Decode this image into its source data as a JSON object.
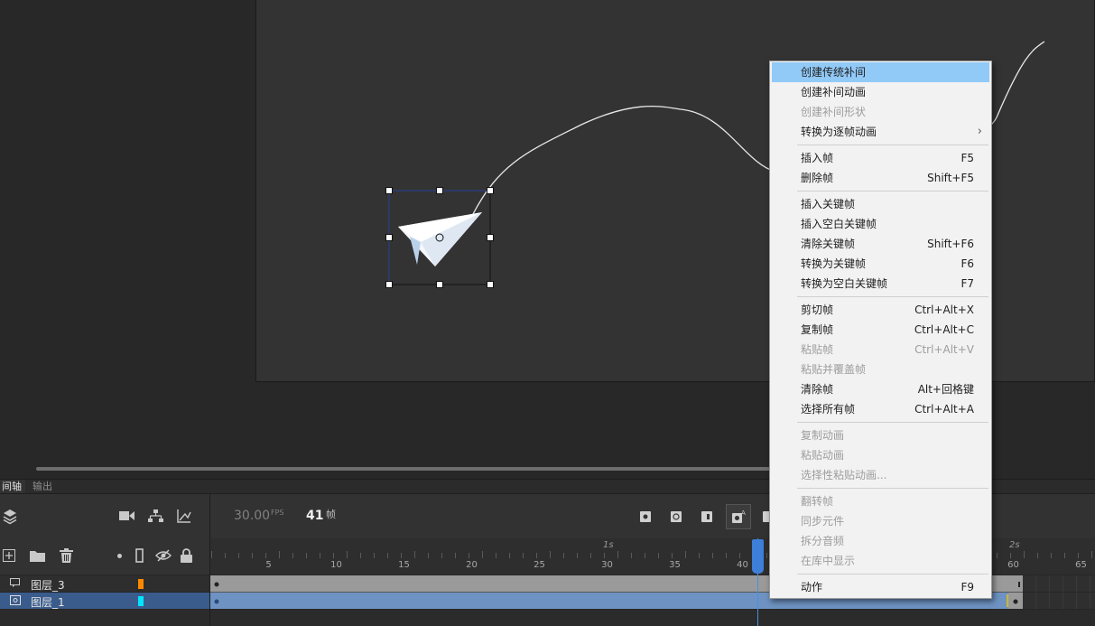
{
  "panel_tabs": {
    "timeline": "间轴",
    "output": "输出"
  },
  "toolbar": {
    "fps": "30.00",
    "fps_unit": "FPS",
    "frame": "41",
    "frame_unit": "帧"
  },
  "ruler": {
    "labels": [
      "5",
      "10",
      "15",
      "20",
      "25",
      "30",
      "35",
      "40",
      "45",
      "50",
      "55",
      "60",
      "65"
    ],
    "seconds": [
      "1s",
      "2s"
    ]
  },
  "layers": [
    {
      "name": "图层_3",
      "color": "#ff8a00",
      "selected": false
    },
    {
      "name": "图层_1",
      "color": "#00e5ff",
      "selected": true
    }
  ],
  "current_frame": 41,
  "context_menu": {
    "items": [
      {
        "label": "创建传统补间",
        "shortcut": "",
        "disabled": false,
        "highlighted": true
      },
      {
        "label": "创建补间动画",
        "shortcut": "",
        "disabled": false
      },
      {
        "label": "创建补间形状",
        "shortcut": "",
        "disabled": true
      },
      {
        "label": "转换为逐帧动画",
        "shortcut": "",
        "disabled": false,
        "submenu": true,
        "submenu_glyph": "›"
      },
      {
        "sep": true
      },
      {
        "label": "插入帧",
        "shortcut": "F5",
        "disabled": false
      },
      {
        "label": "删除帧",
        "shortcut": "Shift+F5",
        "disabled": false
      },
      {
        "sep": true
      },
      {
        "label": "插入关键帧",
        "shortcut": "",
        "disabled": false
      },
      {
        "label": "插入空白关键帧",
        "shortcut": "",
        "disabled": false
      },
      {
        "label": "清除关键帧",
        "shortcut": "Shift+F6",
        "disabled": false
      },
      {
        "label": "转换为关键帧",
        "shortcut": "F6",
        "disabled": false
      },
      {
        "label": "转换为空白关键帧",
        "shortcut": "F7",
        "disabled": false
      },
      {
        "sep": true
      },
      {
        "label": "剪切帧",
        "shortcut": "Ctrl+Alt+X",
        "disabled": false
      },
      {
        "label": "复制帧",
        "shortcut": "Ctrl+Alt+C",
        "disabled": false
      },
      {
        "label": "粘贴帧",
        "shortcut": "Ctrl+Alt+V",
        "disabled": true
      },
      {
        "label": "粘贴并覆盖帧",
        "shortcut": "",
        "disabled": true
      },
      {
        "label": "清除帧",
        "shortcut": "Alt+回格键",
        "disabled": false
      },
      {
        "label": "选择所有帧",
        "shortcut": "Ctrl+Alt+A",
        "disabled": false
      },
      {
        "sep": true
      },
      {
        "label": "复制动画",
        "shortcut": "",
        "disabled": true
      },
      {
        "label": "粘贴动画",
        "shortcut": "",
        "disabled": true
      },
      {
        "label": "选择性粘贴动画...",
        "shortcut": "",
        "disabled": true
      },
      {
        "sep": true
      },
      {
        "label": "翻转帧",
        "shortcut": "",
        "disabled": true
      },
      {
        "label": "同步元件",
        "shortcut": "",
        "disabled": true
      },
      {
        "label": "拆分音频",
        "shortcut": "",
        "disabled": true
      },
      {
        "label": "在库中显示",
        "shortcut": "",
        "disabled": true
      },
      {
        "sep": true
      },
      {
        "label": "动作",
        "shortcut": "F9",
        "disabled": false
      }
    ]
  },
  "icons": {
    "layers": "layers-icon",
    "camera": "camera-icon",
    "parenting": "hierarchy-icon",
    "graph": "graph-icon",
    "new_layer": "new-layer-icon",
    "new_folder": "folder-icon",
    "delete": "trash-icon",
    "highlight": "dot-icon",
    "outline": "outline-icon",
    "visibility": "eye-hidden-icon",
    "lock": "lock-icon"
  }
}
